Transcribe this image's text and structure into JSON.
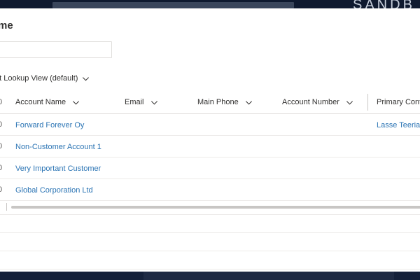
{
  "background": {
    "brand": "SANDB"
  },
  "dialog": {
    "title": "me",
    "view_selector": "nt Lookup View (default)"
  },
  "grid": {
    "columns": [
      {
        "label": "Account Name"
      },
      {
        "label": "Email"
      },
      {
        "label": "Main Phone"
      },
      {
        "label": "Account Number"
      },
      {
        "label": "Primary Cont"
      }
    ],
    "row_marker": "0",
    "rows": [
      {
        "account_name": "Forward Forever Oy",
        "primary_contact": "Lasse Teeriahc"
      },
      {
        "account_name": "Non-Customer Account 1",
        "primary_contact": ""
      },
      {
        "account_name": "Very Important Customer",
        "primary_contact": ""
      },
      {
        "account_name": "Global Corporation Ltd",
        "primary_contact": ""
      }
    ]
  },
  "colors": {
    "link": "#2b74b4",
    "text": "#323130",
    "border": "#e1dfdd",
    "backdrop": "#172238"
  },
  "icons": {
    "column_sort": "chevron-down-icon",
    "view_dropdown": "chevron-down-icon"
  }
}
